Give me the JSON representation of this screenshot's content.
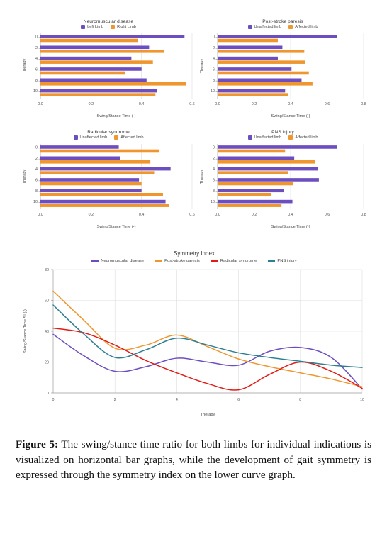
{
  "figure": {
    "caption_label": "Figure 5:",
    "caption_text": " The swing/stance time ratio for both limbs for individual indications is visualized on horizontal bar graphs, while the development of gait symmetry is expressed through the symmetry index on the lower curve graph."
  },
  "colors": {
    "purple": "#6d4ec0",
    "orange": "#f0962f",
    "red": "#e01b18",
    "teal": "#2e7f92",
    "grid": "#dddddd",
    "axis": "#9a9a9a"
  },
  "chart_data": [
    {
      "type": "bar",
      "orientation": "horizontal",
      "title": "Neuromuscular disease",
      "xlabel": "Swing/Stance Time (-)",
      "ylabel": "Therapy",
      "xlim": [
        0.0,
        0.6
      ],
      "xticks": [
        "0.0",
        "0.2",
        "0.4",
        "0.6"
      ],
      "categories": [
        "0",
        "2",
        "4",
        "6",
        "8",
        "10"
      ],
      "legend_position": "top",
      "grid": true,
      "series": [
        {
          "name": "Left Limb",
          "color": "#6d4ec0",
          "values": [
            0.57,
            0.43,
            0.36,
            0.4,
            0.42,
            0.46
          ]
        },
        {
          "name": "Right Limb",
          "color": "#f0962f",
          "values": [
            0.385,
            0.49,
            0.445,
            0.335,
            0.575,
            0.455
          ]
        }
      ]
    },
    {
      "type": "bar",
      "orientation": "horizontal",
      "title": "Post-stroke paresis",
      "xlabel": "Swing/Stance Time (-)",
      "ylabel": "Therapy",
      "xlim": [
        0.0,
        0.8
      ],
      "xticks": [
        "0.0",
        "0.2",
        "0.4",
        "0.6",
        "0.8"
      ],
      "categories": [
        "0",
        "2",
        "4",
        "6",
        "8",
        "10"
      ],
      "legend_position": "top",
      "grid": true,
      "series": [
        {
          "name": "Unaffected limb",
          "color": "#6d4ec0",
          "values": [
            0.655,
            0.355,
            0.33,
            0.405,
            0.46,
            0.37
          ]
        },
        {
          "name": "Affected limb",
          "color": "#f0962f",
          "values": [
            0.33,
            0.475,
            0.48,
            0.5,
            0.52,
            0.385
          ]
        }
      ]
    },
    {
      "type": "bar",
      "orientation": "horizontal",
      "title": "Radicular syndrome",
      "xlabel": "Swing/Stance Time (-)",
      "ylabel": "Therapy",
      "xlim": [
        0.0,
        0.6
      ],
      "xticks": [
        "0.0",
        "0.2",
        "0.4",
        "0.6"
      ],
      "categories": [
        "0",
        "2",
        "4",
        "6",
        "8",
        "10"
      ],
      "legend_position": "top",
      "grid": true,
      "series": [
        {
          "name": "Unaffected limb",
          "color": "#6d4ec0",
          "values": [
            0.31,
            0.315,
            0.515,
            0.39,
            0.4,
            0.495
          ]
        },
        {
          "name": "Affected limb",
          "color": "#f0962f",
          "values": [
            0.47,
            0.435,
            0.45,
            0.4,
            0.485,
            0.51
          ]
        }
      ]
    },
    {
      "type": "bar",
      "orientation": "horizontal",
      "title": "PNS injury",
      "xlabel": "Swing/Stance Time (-)",
      "ylabel": "Therapy",
      "xlim": [
        0.0,
        0.8
      ],
      "xticks": [
        "0.0",
        "0.2",
        "0.4",
        "0.6",
        "0.8"
      ],
      "categories": [
        "0",
        "2",
        "4",
        "6",
        "8",
        "10"
      ],
      "legend_position": "top",
      "grid": true,
      "series": [
        {
          "name": "Unaffected limb",
          "color": "#6d4ec0",
          "values": [
            0.655,
            0.42,
            0.55,
            0.555,
            0.365,
            0.41
          ]
        },
        {
          "name": "Affected limb",
          "color": "#f0962f",
          "values": [
            0.37,
            0.535,
            0.385,
            0.415,
            0.295,
            0.35
          ]
        }
      ]
    },
    {
      "type": "line",
      "title": "Symmetry Index",
      "xlabel": "Therapy",
      "ylabel": "Swing/Stance Time SI (-)",
      "xlim": [
        0,
        10
      ],
      "ylim": [
        0,
        80
      ],
      "xticks": [
        "0",
        "2",
        "4",
        "6",
        "8",
        "10"
      ],
      "yticks": [
        "0",
        "20",
        "40",
        "60",
        "80"
      ],
      "x": [
        0,
        1,
        2,
        3,
        4,
        5,
        6,
        7,
        8,
        9,
        10
      ],
      "legend_position": "top",
      "grid": true,
      "series": [
        {
          "name": "Neuromuscular disease",
          "color": "#6d4ec0",
          "values": [
            38,
            24,
            14,
            17,
            22.5,
            20,
            18,
            27,
            29.5,
            23,
            2.5
          ]
        },
        {
          "name": "Post-stroke paresis",
          "color": "#f0962f",
          "values": [
            66,
            47,
            29,
            31,
            37.5,
            30,
            22,
            17,
            13,
            9,
            4
          ]
        },
        {
          "name": "Radicular syndrome",
          "color": "#e01b18",
          "values": [
            42,
            39,
            31,
            21,
            13,
            6,
            2,
            12,
            20,
            14,
            3
          ]
        },
        {
          "name": "PNS injury",
          "color": "#2e7f92",
          "values": [
            57,
            38,
            23,
            28,
            35.5,
            31,
            26,
            23,
            20.5,
            18,
            16.5
          ]
        }
      ]
    }
  ]
}
